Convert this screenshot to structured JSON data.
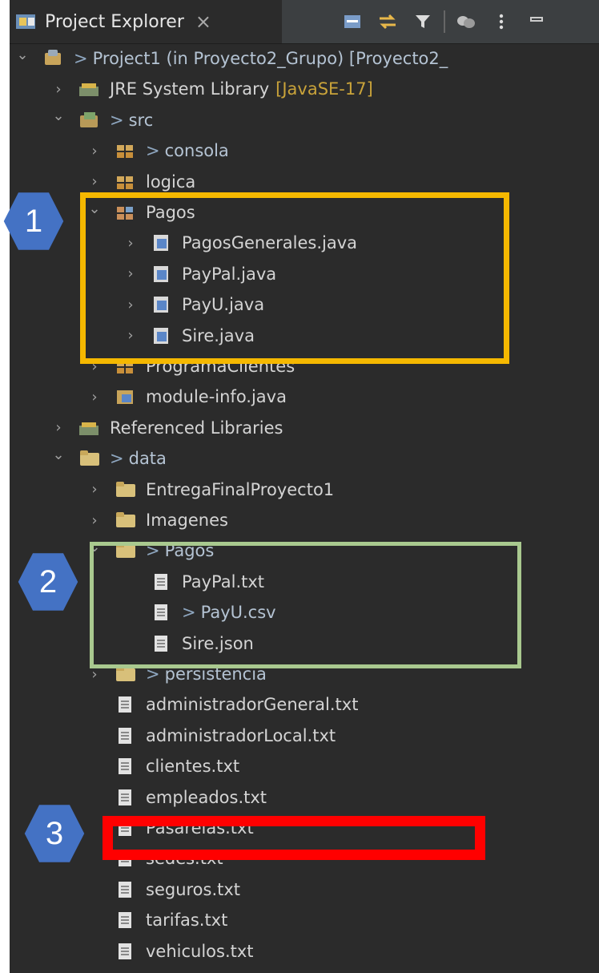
{
  "view": {
    "tab_title": "Project Explorer",
    "tab_close": "×"
  },
  "tree": [
    {
      "indent": 0,
      "arrow": "expanded",
      "icon": "project-icon",
      "prefix": ">",
      "label": "Project1 (in Proyecto2_Grupo) [Proyecto2_",
      "dim": true
    },
    {
      "indent": 1,
      "arrow": "collapsed",
      "icon": "library-icon",
      "label": "JRE System Library",
      "decoration": "[JavaSE-17]"
    },
    {
      "indent": 1,
      "arrow": "expanded",
      "icon": "source-folder-icon",
      "prefix": ">",
      "label": "src",
      "dim": true
    },
    {
      "indent": 2,
      "arrow": "collapsed",
      "icon": "package-icon",
      "prefix": ">",
      "label": "consola",
      "dim": true
    },
    {
      "indent": 2,
      "arrow": "collapsed",
      "icon": "package-icon",
      "label": "logica"
    },
    {
      "indent": 2,
      "arrow": "expanded",
      "icon": "package-open-icon",
      "label": "Pagos"
    },
    {
      "indent": 3,
      "arrow": "collapsed",
      "icon": "java-file-icon",
      "label": "PagosGenerales.java"
    },
    {
      "indent": 3,
      "arrow": "collapsed",
      "icon": "java-file-icon",
      "label": "PayPal.java"
    },
    {
      "indent": 3,
      "arrow": "collapsed",
      "icon": "java-file-icon",
      "label": "PayU.java"
    },
    {
      "indent": 3,
      "arrow": "collapsed",
      "icon": "java-file-icon",
      "label": "Sire.java"
    },
    {
      "indent": 2,
      "arrow": "collapsed",
      "icon": "package-icon",
      "label": "ProgramaClientes"
    },
    {
      "indent": 2,
      "arrow": "collapsed",
      "icon": "module-file-icon",
      "label": "module-info.java"
    },
    {
      "indent": 1,
      "arrow": "collapsed",
      "icon": "library-icon",
      "label": "Referenced Libraries"
    },
    {
      "indent": 1,
      "arrow": "expanded",
      "icon": "folder-icon",
      "prefix": ">",
      "label": "data",
      "dim": true
    },
    {
      "indent": 2,
      "arrow": "collapsed",
      "icon": "folder-icon",
      "label": "EntregaFinalProyecto1"
    },
    {
      "indent": 2,
      "arrow": "collapsed",
      "icon": "folder-icon",
      "label": "Imagenes"
    },
    {
      "indent": 2,
      "arrow": "expanded",
      "icon": "folder-icon",
      "prefix": ">",
      "label": "Pagos",
      "dim": true
    },
    {
      "indent": 3,
      "arrow": "none",
      "icon": "text-file-icon",
      "label": "PayPal.txt"
    },
    {
      "indent": 3,
      "arrow": "none",
      "icon": "text-file-icon",
      "prefix": ">",
      "label": "PayU.csv",
      "dim": true
    },
    {
      "indent": 3,
      "arrow": "none",
      "icon": "text-file-icon",
      "label": "Sire.json"
    },
    {
      "indent": 2,
      "arrow": "collapsed",
      "icon": "folder-icon",
      "prefix": ">",
      "label": "persistencia",
      "dim": true
    },
    {
      "indent": 2,
      "arrow": "none",
      "icon": "text-file-icon",
      "label": "administradorGeneral.txt"
    },
    {
      "indent": 2,
      "arrow": "none",
      "icon": "text-file-icon",
      "label": "administradorLocal.txt"
    },
    {
      "indent": 2,
      "arrow": "none",
      "icon": "text-file-icon",
      "label": "clientes.txt"
    },
    {
      "indent": 2,
      "arrow": "none",
      "icon": "text-file-icon",
      "label": "empleados.txt"
    },
    {
      "indent": 2,
      "arrow": "none",
      "icon": "text-file-icon",
      "label": "Pasarelas.txt"
    },
    {
      "indent": 2,
      "arrow": "none",
      "icon": "text-file-icon",
      "label": "sedes.txt"
    },
    {
      "indent": 2,
      "arrow": "none",
      "icon": "text-file-icon",
      "label": "seguros.txt"
    },
    {
      "indent": 2,
      "arrow": "none",
      "icon": "text-file-icon",
      "label": "tarifas.txt"
    },
    {
      "indent": 2,
      "arrow": "none",
      "icon": "text-file-icon",
      "label": "vehiculos.txt"
    }
  ],
  "annotations": {
    "badge1": "1",
    "badge2": "2",
    "badge3": "3",
    "colors": {
      "box1": "#f5b800",
      "box2": "#a9c98f",
      "box3": "#ff0000",
      "badge": "#4472c4"
    }
  }
}
